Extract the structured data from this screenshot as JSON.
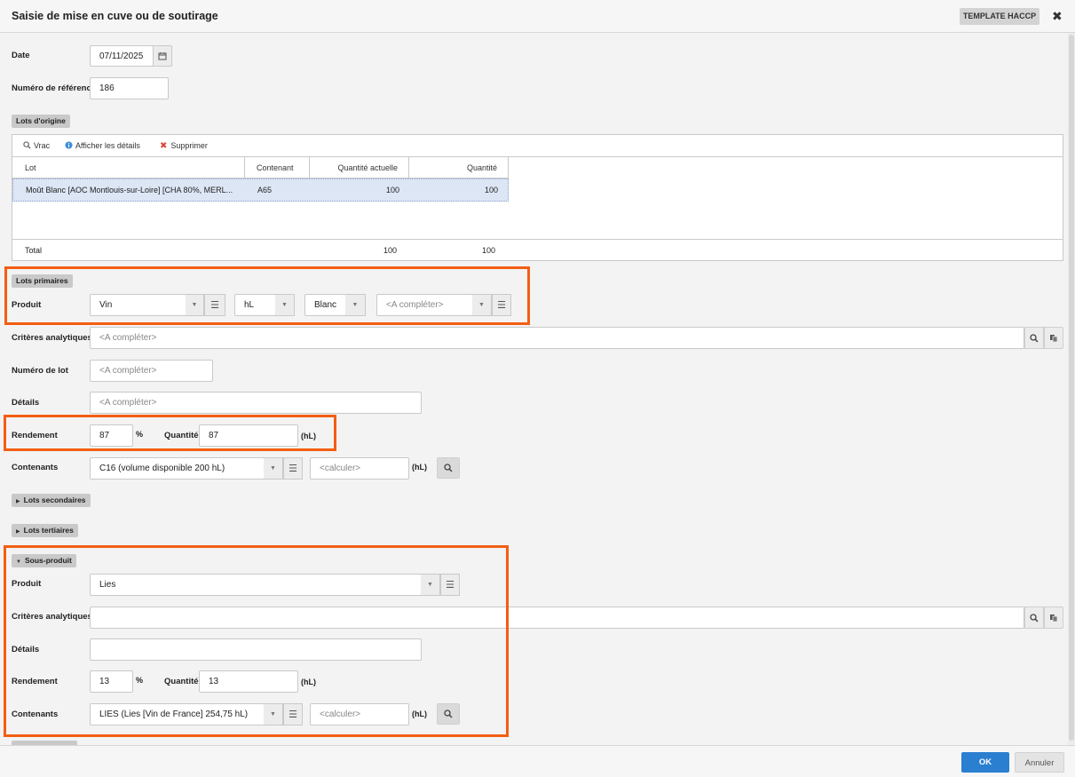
{
  "window": {
    "title": "Saisie de mise en cuve ou de soutirage",
    "template_button": "TEMPLATE HACCP",
    "close_glyph": "✖"
  },
  "form": {
    "date_label": "Date",
    "date_value": "07/11/2025",
    "reference_label": "Numéro de référence",
    "reference_value": "186"
  },
  "lots_origine": {
    "section_label": "Lots d'origine",
    "toolbar": {
      "vrac": "Vrac",
      "details": "Afficher les détails",
      "delete": "Supprimer"
    },
    "columns": [
      "Lot",
      "Contenant",
      "Quantité actuelle",
      "Quantité"
    ],
    "rows": [
      {
        "lot": "Moût Blanc [AOC Montlouis-sur-Loire] [CHA 80%, MERL...",
        "contenant": "A65",
        "quantite_actuelle": "100",
        "quantite": "100"
      }
    ],
    "total_label": "Total",
    "total_actuelle": "100",
    "total_quantite": "100"
  },
  "lots_primaires": {
    "section_label": "Lots primaires",
    "produit_label": "Produit",
    "produit_value": "Vin",
    "unit_value": "hL",
    "color_value": "Blanc",
    "extra_placeholder": "<A compléter>",
    "criteres_label": "Critères analytiques",
    "criteres_placeholder": "<A compléter>",
    "numero_lot_label": "Numéro de lot",
    "numero_lot_placeholder": "<A compléter>",
    "details_label": "Détails",
    "details_placeholder": "<A compléter>",
    "rendement_label": "Rendement",
    "rendement_value": "87",
    "percent": "%",
    "quantite_label": "Quantité",
    "quantite_value": "87",
    "unit_hl": "(hL)",
    "contenants_label": "Contenants",
    "contenant_value": "C16 (volume disponible 200 hL)",
    "calc_placeholder": "<calculer>"
  },
  "lots_secondaires": {
    "section_label": "Lots secondaires"
  },
  "lots_tertiaires": {
    "section_label": "Lots tertiaires"
  },
  "sous_produit": {
    "section_label": "Sous-produit",
    "produit_label": "Produit",
    "produit_value": "Lies",
    "criteres_label": "Critères analytiques",
    "details_label": "Détails",
    "rendement_label": "Rendement",
    "rendement_value": "13",
    "percent": "%",
    "quantite_label": "Quantité",
    "quantite_value": "13",
    "unit_hl": "(hL)",
    "contenants_label": "Contenants",
    "contenant_value": "LIES (Lies [Vin de France] 254,75 hL)",
    "calc_placeholder": "<calculer>"
  },
  "footer": {
    "ok": "OK",
    "cancel": "Annuler"
  },
  "colors": {
    "highlight": "#f35e12",
    "primary_button": "#2b7fd1",
    "selected_row": "#dde6f5"
  }
}
